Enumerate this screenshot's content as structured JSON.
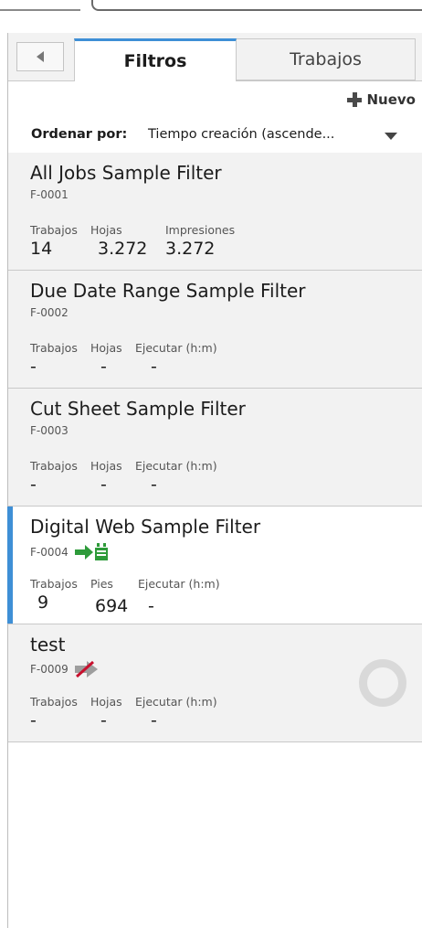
{
  "tabs": [
    {
      "label": "Filtros",
      "active": true
    },
    {
      "label": "Trabajos",
      "active": false
    }
  ],
  "new_button": {
    "label": "Nuevo"
  },
  "sort": {
    "label": "Ordenar por:",
    "value": "Tiempo creación (ascende..."
  },
  "filters": [
    {
      "title": "All Jobs Sample Filter",
      "id": "F-0001",
      "selected": false,
      "metrics": [
        {
          "label": "Trabajos",
          "value": "14"
        },
        {
          "label": "Hojas",
          "value": "3.272"
        },
        {
          "label": "Impresiones",
          "value": "3.272"
        }
      ]
    },
    {
      "title": "Due Date Range Sample Filter",
      "id": "F-0002",
      "selected": false,
      "metrics": [
        {
          "label": "Trabajos",
          "value": "-"
        },
        {
          "label": "Hojas",
          "value": "-"
        },
        {
          "label": "Ejecutar (h:m)",
          "value": "-"
        }
      ]
    },
    {
      "title": "Cut Sheet Sample Filter",
      "id": "F-0003",
      "selected": false,
      "metrics": [
        {
          "label": "Trabajos",
          "value": "-"
        },
        {
          "label": "Hojas",
          "value": "-"
        },
        {
          "label": "Ejecutar (h:m)",
          "value": "-"
        }
      ]
    },
    {
      "title": "Digital Web Sample Filter",
      "id": "F-0004",
      "selected": true,
      "badge_icon": "green-arrow-printer-icon",
      "metrics": [
        {
          "label": "Trabajos",
          "value": "9"
        },
        {
          "label": "Pies",
          "value": "694"
        },
        {
          "label": "Ejecutar (h:m)",
          "value": "-"
        }
      ]
    },
    {
      "title": "test",
      "id": "F-0009",
      "selected": false,
      "badge_icon": "disabled-arrow-icon",
      "loading": true,
      "metrics": [
        {
          "label": "Trabajos",
          "value": "-"
        },
        {
          "label": "Hojas",
          "value": "-"
        },
        {
          "label": "Ejecutar (h:m)",
          "value": "-"
        }
      ]
    }
  ],
  "colors": {
    "accent": "#3e8fd6",
    "badge_green": "#2e9b3a",
    "badge_red": "#c8102e"
  }
}
